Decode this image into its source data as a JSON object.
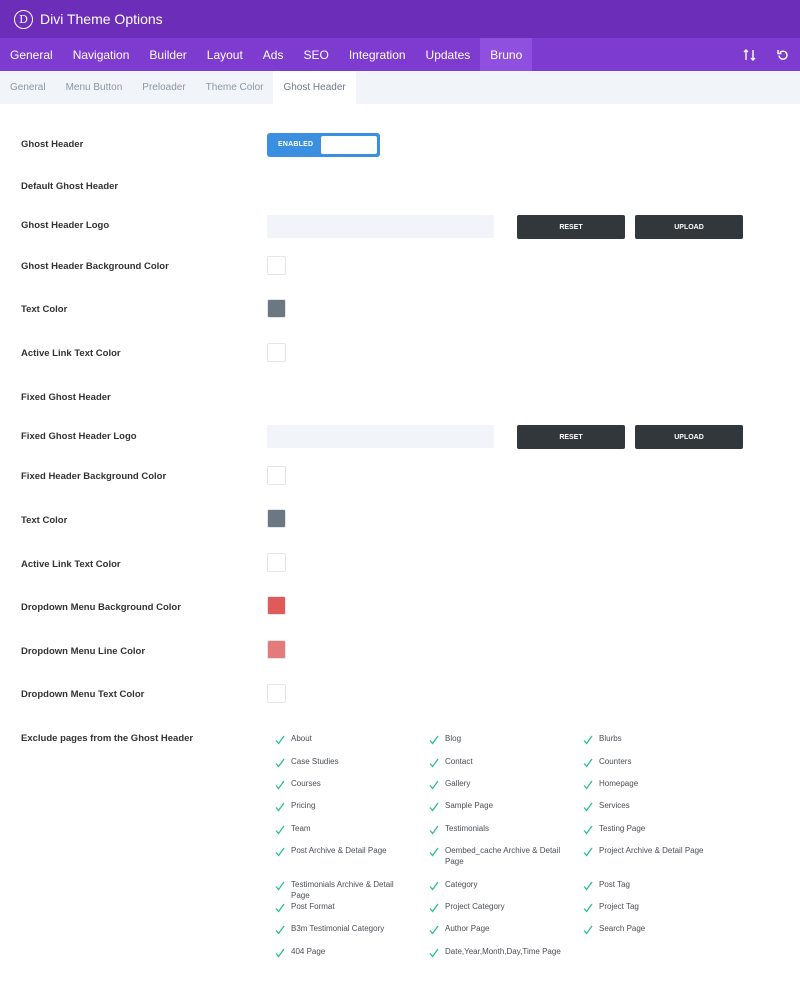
{
  "header": {
    "logo_letter": "D",
    "title": "Divi Theme Options"
  },
  "main_tabs": [
    "General",
    "Navigation",
    "Builder",
    "Layout",
    "Ads",
    "SEO",
    "Integration",
    "Updates",
    "Bruno"
  ],
  "nav_icons": [
    "sort-icon",
    "undo-icon"
  ],
  "sub_tabs": [
    "General",
    "Menu Button",
    "Preloader",
    "Theme Color",
    "Ghost Header"
  ],
  "settings": {
    "ghost_header": {
      "label": "Ghost Header",
      "toggle": "ENABLED"
    },
    "default_section": "Default Ghost Header",
    "logo": {
      "label": "Ghost Header Logo",
      "reset": "RESET",
      "upload": "UPLOAD"
    },
    "bg_color": {
      "label": "Ghost Header Background Color",
      "color": "#ffffff"
    },
    "text_color": {
      "label": "Text Color",
      "color": "#6b7782"
    },
    "active_link": {
      "label": "Active Link Text Color",
      "color": "#ffffff"
    },
    "fixed_section": "Fixed Ghost Header",
    "fixed_logo": {
      "label": "Fixed Ghost Header Logo",
      "reset": "RESET",
      "upload": "UPLOAD"
    },
    "fixed_bg_color": {
      "label": "Fixed Header Background Color",
      "color": "#ffffff"
    },
    "fixed_text_color": {
      "label": "Text Color",
      "color": "#6b7782"
    },
    "fixed_active_link": {
      "label": "Active Link Text Color",
      "color": "#ffffff"
    },
    "dropdown_bg": {
      "label": "Dropdown Menu Background Color",
      "color": "#e05a5a"
    },
    "dropdown_line": {
      "label": "Dropdown Menu Line Color",
      "color": "#e57a7a"
    },
    "dropdown_text": {
      "label": "Dropdown Menu Text Color",
      "color": "#ffffff"
    },
    "exclude_label": "Exclude pages from the Ghost Header"
  },
  "exclude_pages": [
    "About",
    "Blog",
    "Blurbs",
    "Case Studies",
    "Contact",
    "Counters",
    "Courses",
    "Gallery",
    "Homepage",
    "Pricing",
    "Sample Page",
    "Services",
    "Team",
    "Testimonials",
    "Testing Page",
    "Post Archive & Detail Page",
    "Oembed_cache Archive & Detail Page",
    "Project Archive & Detail Page",
    "Testimonials Archive & Detail Page",
    "Category",
    "Post Tag",
    "Post Format",
    "Project Category",
    "Project Tag",
    "B3m Testimonial Category",
    "Author Page",
    "Search Page",
    "404 Page",
    "Date,Year,Month,Day,Time Page"
  ],
  "colors": {
    "accent": "#6c2eb9",
    "nav": "#7e3bd0",
    "check": "#2bbf8a",
    "button": "#32373c"
  }
}
